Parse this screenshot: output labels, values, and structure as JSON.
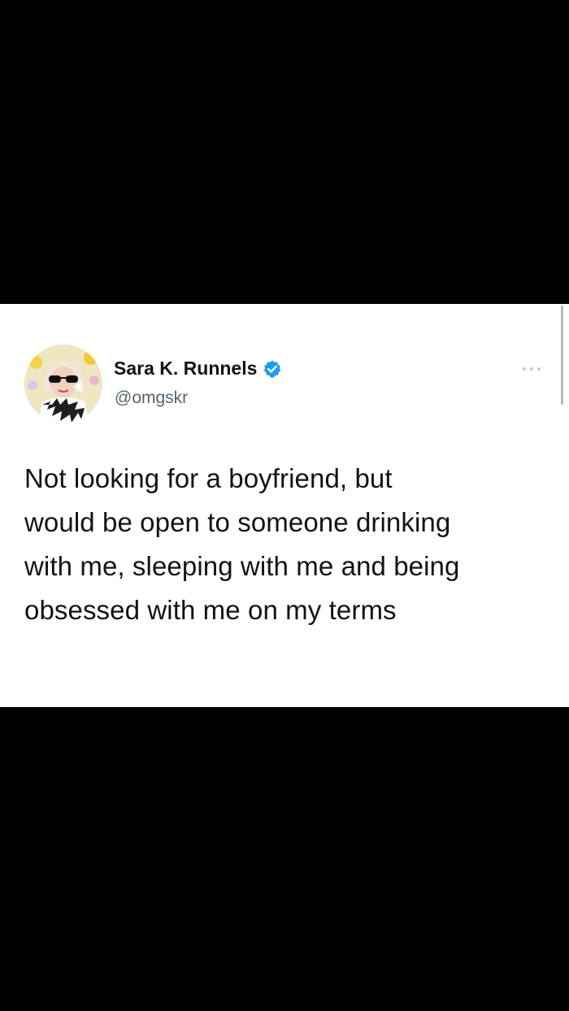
{
  "tweet": {
    "author": {
      "display_name": "Sara K. Runnels",
      "handle": "@omgskr",
      "verified": true,
      "verified_icon": "verified-badge-icon",
      "avatar_icon": "profile-avatar"
    },
    "more_icon": "more-options-icon",
    "text_lines": [
      "Not looking for a boyfriend, but",
      "would be open to someone drinking",
      "with me, sleeping with me and being",
      "obsessed with me on my terms"
    ]
  },
  "colors": {
    "background": "#000000",
    "card": "#ffffff",
    "text_primary": "#0f1419",
    "text_secondary": "#536471",
    "verified_blue": "#1d9bf0"
  }
}
